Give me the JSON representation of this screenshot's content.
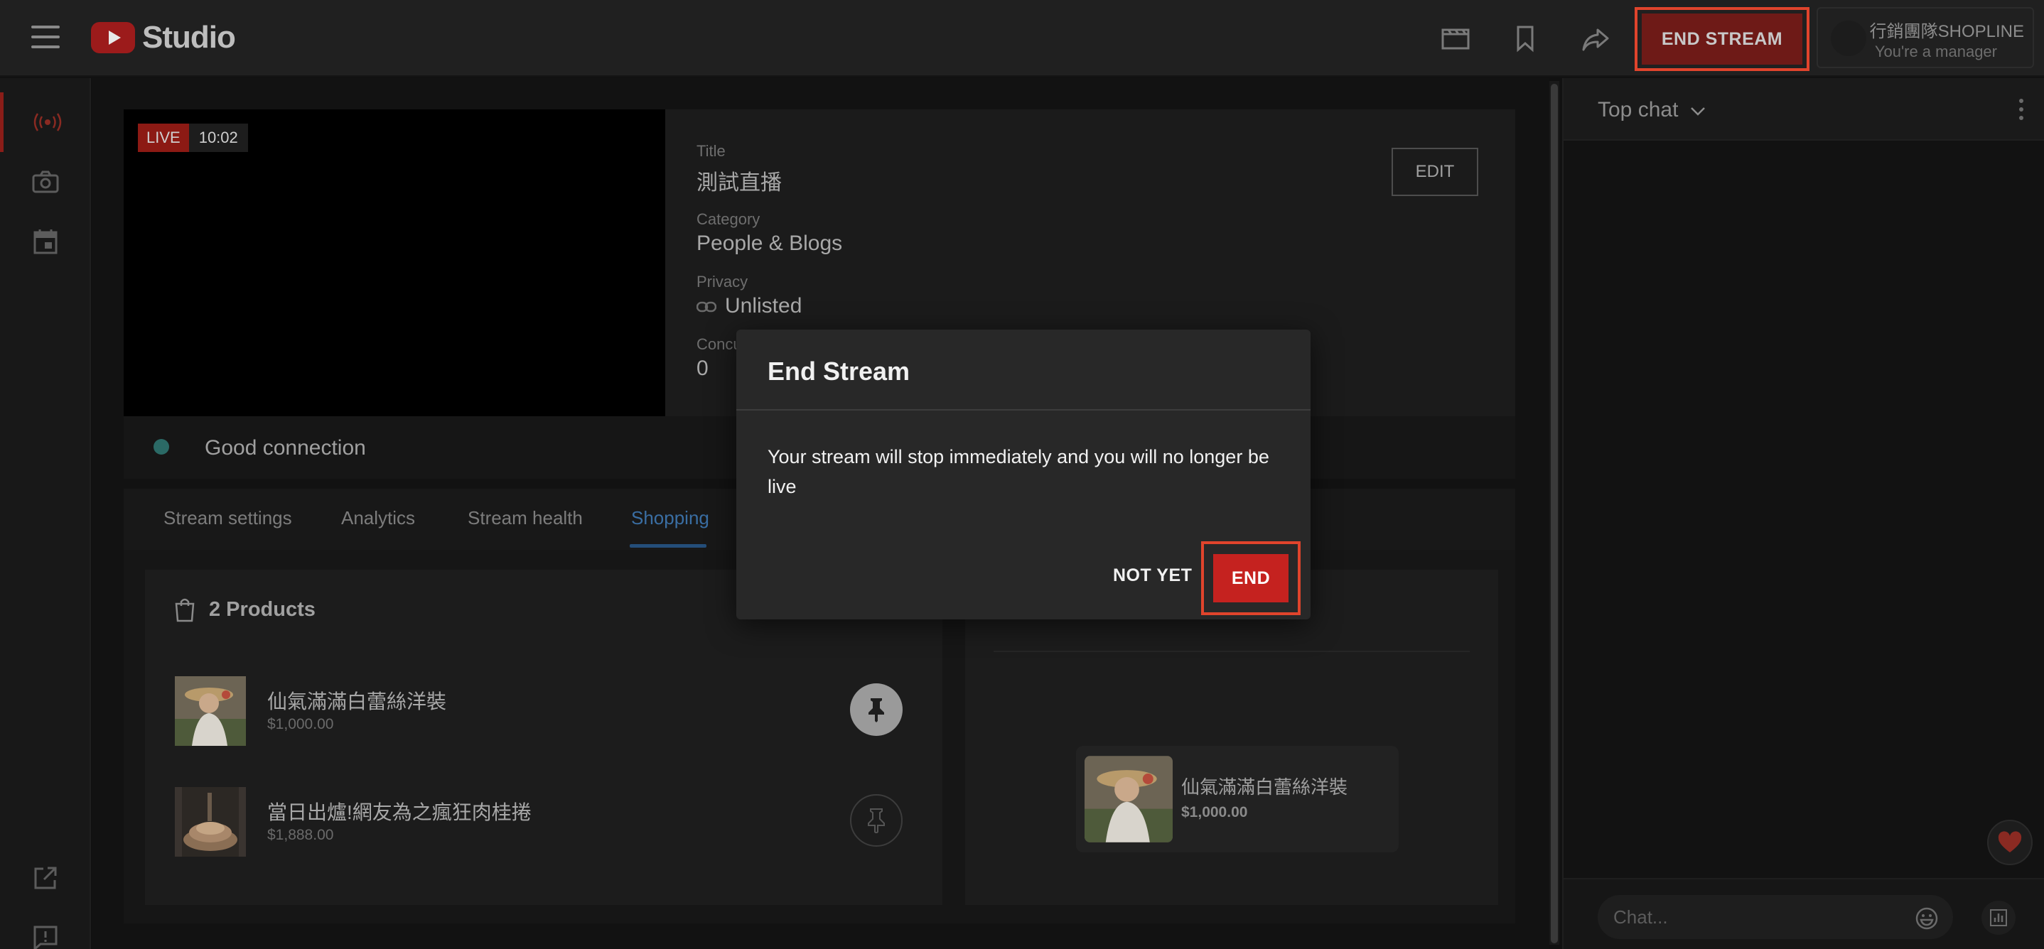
{
  "header": {
    "logo_text": "Studio",
    "end_stream_label": "END STREAM",
    "account_name": "行銷團隊SHOPLINE",
    "account_role": "You're a manager"
  },
  "stream": {
    "live_label": "LIVE",
    "elapsed": "10:02",
    "title_label": "Title",
    "title_value": "測試直播",
    "category_label": "Category",
    "category_value": "People & Blogs",
    "privacy_label": "Privacy",
    "privacy_value": "Unlisted",
    "concurrent_label": "Concu",
    "concurrent_value": "0",
    "edit_label": "EDIT",
    "connection": "Good connection"
  },
  "tabs": [
    {
      "label": "Stream settings"
    },
    {
      "label": "Analytics"
    },
    {
      "label": "Stream health"
    },
    {
      "label": "Shopping"
    }
  ],
  "shopping": {
    "products_header": "2 Products",
    "products": [
      {
        "name": "仙氣滿滿白蕾絲洋裝",
        "price": "$1,000.00",
        "pinned": true
      },
      {
        "name": "當日出爐!網友為之瘋狂肉桂捲",
        "price": "$1,888.00",
        "pinned": false
      }
    ],
    "pinned_product": {
      "name": "仙氣滿滿白蕾絲洋裝",
      "price": "$1,000.00"
    }
  },
  "chat": {
    "title": "Top chat",
    "input_placeholder": "Chat..."
  },
  "modal": {
    "title": "End Stream",
    "body": "Your stream will stop immediately and you will no longer be live",
    "not_yet_label": "NOT YET",
    "end_label": "END"
  },
  "colors": {
    "accent_red": "#c5221f",
    "highlight_border": "#e0442c",
    "active_tab": "#3a6ea3"
  }
}
